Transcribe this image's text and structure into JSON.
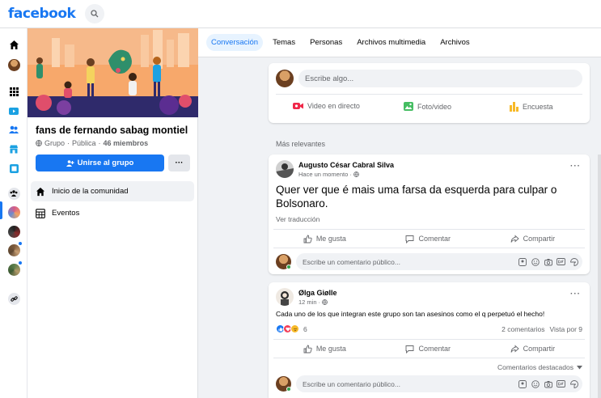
{
  "brand": {
    "logo_text": "facebook",
    "accent": "#1877f2"
  },
  "group": {
    "name": "fans de fernando sabag montiel",
    "type": "Grupo",
    "privacy": "Pública",
    "members": "46 miembros",
    "join_label": "Unirse al grupo",
    "more_label": "···",
    "nav": [
      {
        "label": "Inicio de la comunidad",
        "icon": "home-icon"
      },
      {
        "label": "Eventos",
        "icon": "calendar-icon"
      }
    ]
  },
  "tabs": [
    {
      "label": "Conversación",
      "active": true
    },
    {
      "label": "Temas"
    },
    {
      "label": "Personas"
    },
    {
      "label": "Archivos multimedia"
    },
    {
      "label": "Archivos"
    }
  ],
  "composer": {
    "placeholder": "Escribe algo...",
    "actions": [
      {
        "label": "Video en directo",
        "icon": "live-video-icon",
        "color": "#f02849"
      },
      {
        "label": "Foto/video",
        "icon": "photo-icon",
        "color": "#45bd62"
      },
      {
        "label": "Encuesta",
        "icon": "poll-icon",
        "color": "#f7b928"
      }
    ]
  },
  "feed": {
    "section_label": "Más relevantes",
    "posts": [
      {
        "author": "Augusto César Cabral Silva",
        "time": "Hace un momento",
        "text": "Quer ver que é mais uma farsa da esquerda para culpar o Bolsonaro.",
        "translate": "Ver traducción",
        "like": "Me gusta",
        "comment": "Comentar",
        "share": "Compartir",
        "comment_placeholder": "Escribe un comentario público..."
      },
      {
        "author": "Ølga Giølle",
        "time": "12 min",
        "text": "Cada uno de los que integran este grupo son tan asesinos como el q perpetuó el hecho!",
        "reaction_count": "6",
        "comments": "2 comentarios",
        "views": "Vista por 9",
        "like": "Me gusta",
        "comment": "Comentar",
        "share": "Compartir",
        "sort": "Comentarios destacados",
        "comment_placeholder": "Escribe un comentario público..."
      }
    ]
  }
}
